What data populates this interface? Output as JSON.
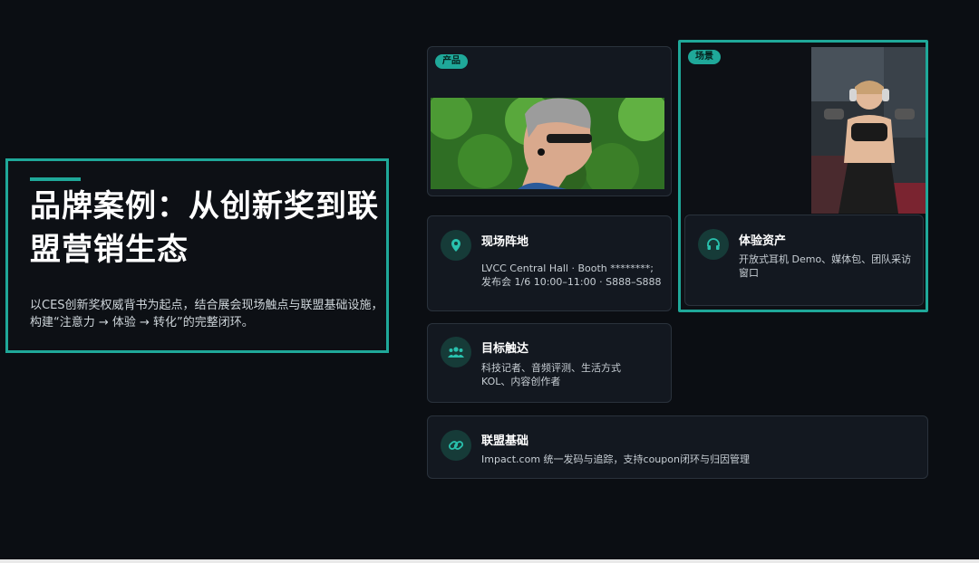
{
  "hero": {
    "title": "品牌案例：从创新奖到联盟营销生态",
    "subtitle": "以CES创新奖权威背书为起点，结合展会现场触点与联盟基础设施，构建“注意力 → 体验 → 转化”的完整闭环。"
  },
  "product": {
    "badge": "产品"
  },
  "scene": {
    "badge": "场景"
  },
  "site": {
    "title": "现场阵地",
    "line1": "LVCC Central Hall · Booth ********;",
    "line2": "发布会 1/6 10:00–11:00 · S888–S888"
  },
  "experience": {
    "title": "体验资产",
    "text": "开放式耳机 Demo、媒体包、团队采访窗口"
  },
  "target": {
    "title": "目标触达",
    "line1": "科技记者、音频评测、生活方式",
    "line2": "KOL、内容创作者"
  },
  "alliance": {
    "title": "联盟基础",
    "text": "Impact.com 统一发码与追踪，支持coupon闭环与归因管理"
  },
  "colors": {
    "accent": "#1fa899",
    "background": "#0b0e13",
    "card": "#131820"
  }
}
